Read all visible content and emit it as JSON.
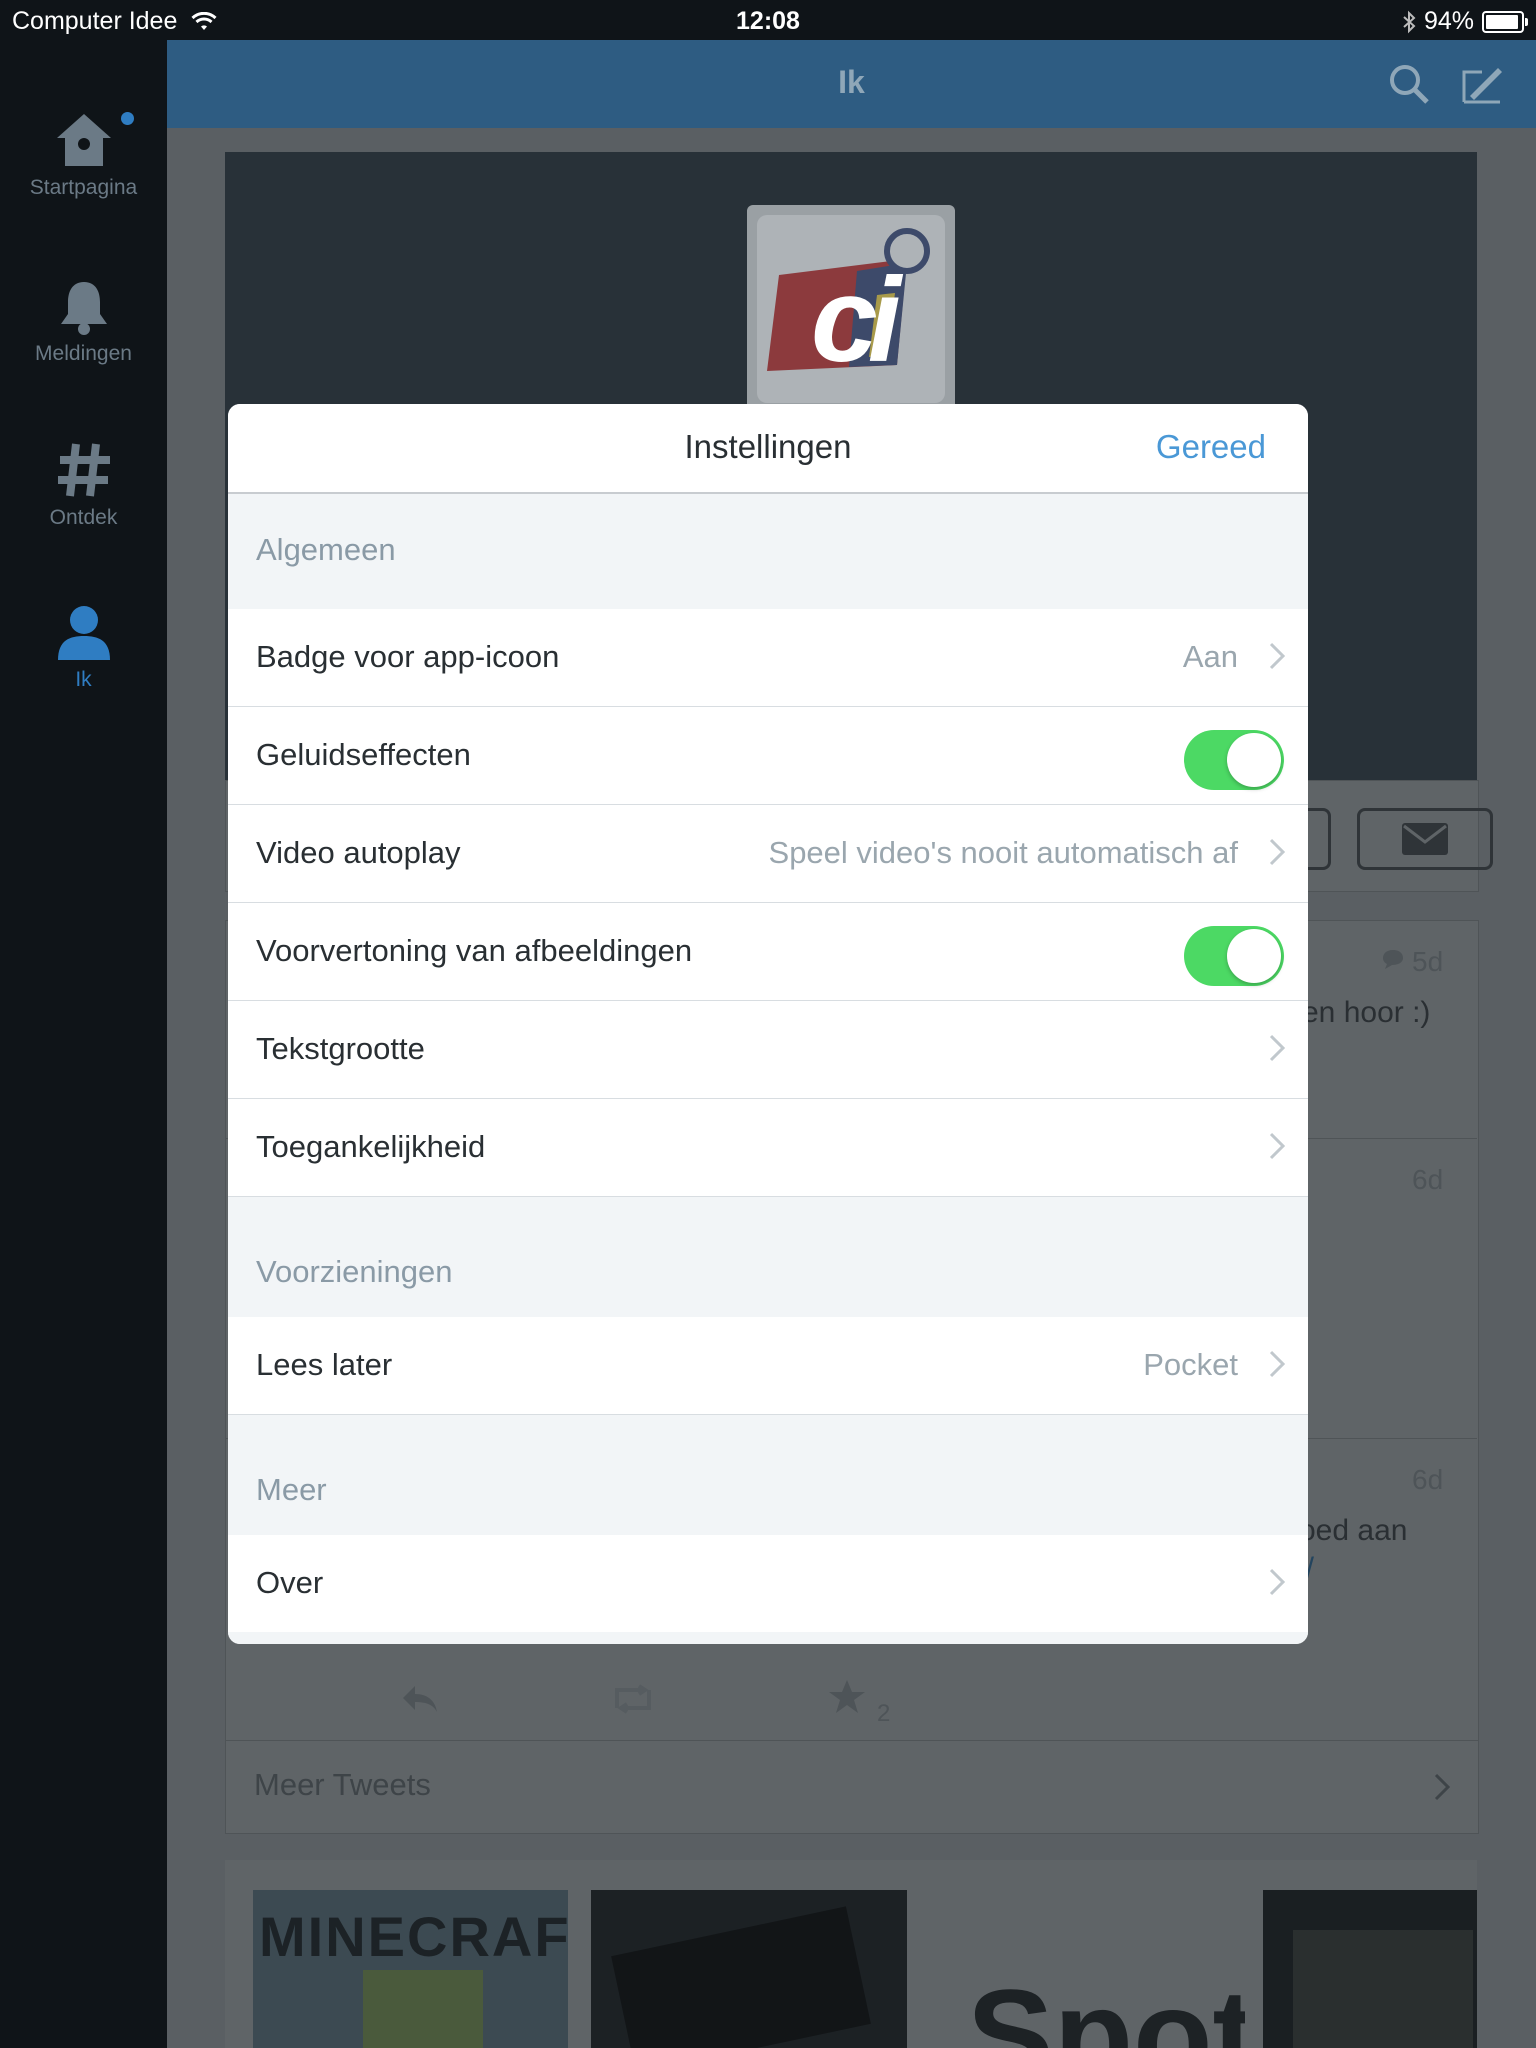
{
  "status": {
    "carrier": "Computer Idee",
    "time": "12:08",
    "battery_text": "94%",
    "battery_level": 0.94
  },
  "sidebar": {
    "items": [
      {
        "label": "Startpagina",
        "icon": "home-icon"
      },
      {
        "label": "Meldingen",
        "icon": "bell-icon"
      },
      {
        "label": "Ontdek",
        "icon": "hashtag-icon"
      },
      {
        "label": "Ik",
        "icon": "person-icon"
      }
    ]
  },
  "header": {
    "title": "Ik"
  },
  "profile": {
    "avatar_text": "ci"
  },
  "background_tweets": [
    {
      "time": "5d",
      "text": "en hoor :)"
    },
    {
      "time": "6d",
      "text": ""
    },
    {
      "time": "6d",
      "text": "oed aan",
      "link": "l/"
    }
  ],
  "tweet_actions": {
    "favorite_count": "2"
  },
  "meer_tweets": "Meer Tweets",
  "thumbnails": {
    "minecraft": "MINECRAFT",
    "spotify": "Spot"
  },
  "modal": {
    "title": "Instellingen",
    "done": "Gereed",
    "sections": {
      "general": "Algemeen",
      "features": "Voorzieningen",
      "more": "Meer"
    },
    "rows": {
      "badge": {
        "label": "Badge voor app-icoon",
        "value": "Aan"
      },
      "sound": {
        "label": "Geluidseffecten",
        "on": true
      },
      "video": {
        "label": "Video autoplay",
        "value": "Speel video's nooit automatisch af"
      },
      "preview": {
        "label": "Voorvertoning van afbeeldingen",
        "on": true
      },
      "textsize": {
        "label": "Tekstgrootte"
      },
      "accessibility": {
        "label": "Toegankelijkheid"
      },
      "readlater": {
        "label": "Lees later",
        "value": "Pocket"
      },
      "about": {
        "label": "Over"
      }
    }
  },
  "colors": {
    "accent": "#4a98d6",
    "toggle_on": "#4cd964",
    "header_bg": "#2e5c82"
  }
}
